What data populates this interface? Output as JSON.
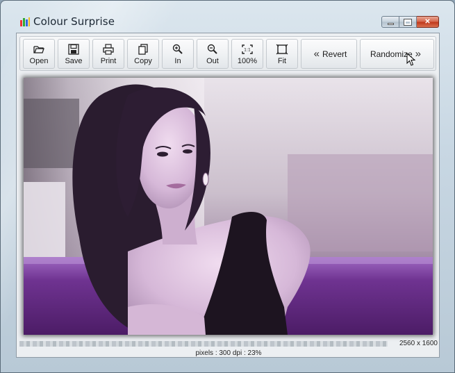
{
  "window": {
    "title": "Colour Surprise",
    "app_icon": "color-bars-icon"
  },
  "caption_buttons": {
    "minimize_icon": "minimize-icon",
    "maximize_icon": "maximize-icon",
    "close_label": "✕"
  },
  "toolbar": {
    "buttons": [
      {
        "label": "Open",
        "icon": "folder-open-icon"
      },
      {
        "label": "Save",
        "icon": "floppy-disk-icon"
      },
      {
        "label": "Print",
        "icon": "printer-icon"
      },
      {
        "label": "Copy",
        "icon": "copy-icon"
      },
      {
        "label": "In",
        "icon": "zoom-in-icon"
      },
      {
        "label": "Out",
        "icon": "zoom-out-icon"
      },
      {
        "label": "100%",
        "icon": "actual-size-icon"
      },
      {
        "label": "Fit",
        "icon": "fit-to-window-icon"
      }
    ],
    "revert": {
      "label": "Revert",
      "icon": "double-chevron-left-icon"
    },
    "randomize": {
      "label": "Randomize",
      "icon": "double-chevron-right-icon"
    }
  },
  "image": {
    "description_icon": "photo-canvas",
    "colors": {
      "tint": "#8a5bb0",
      "dark": "#1d1420",
      "bar": "#6c2e8e"
    }
  },
  "status": {
    "dimensions": "2560 x 1600",
    "info": "pixels : 300 dpi : 23%"
  }
}
